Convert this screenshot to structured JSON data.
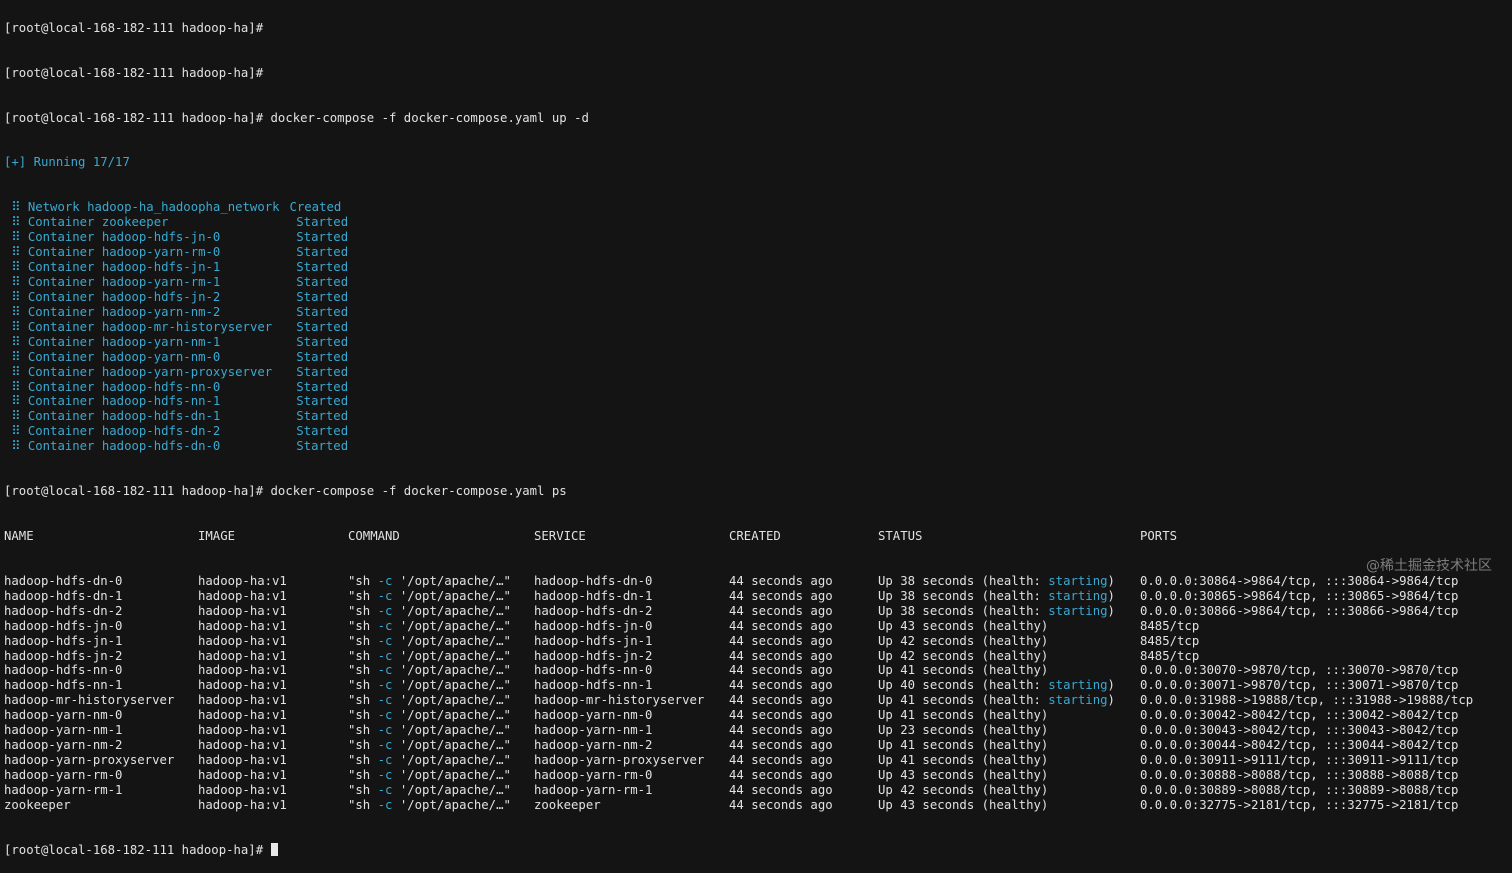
{
  "prompt": "[root@local-168-182-111 hadoop-ha]#",
  "up_command": "docker-compose -f docker-compose.yaml up -d",
  "ps_command": "docker-compose -f docker-compose.yaml ps",
  "running_status": "[+] Running 17/17",
  "compose_events": [
    {
      "kind": "Network",
      "name": "hadoop-ha_hadoopha_network",
      "state": "Created"
    },
    {
      "kind": "Container",
      "name": "zookeeper",
      "state": "Started"
    },
    {
      "kind": "Container",
      "name": "hadoop-hdfs-jn-0",
      "state": "Started"
    },
    {
      "kind": "Container",
      "name": "hadoop-yarn-rm-0",
      "state": "Started"
    },
    {
      "kind": "Container",
      "name": "hadoop-hdfs-jn-1",
      "state": "Started"
    },
    {
      "kind": "Container",
      "name": "hadoop-yarn-rm-1",
      "state": "Started"
    },
    {
      "kind": "Container",
      "name": "hadoop-hdfs-jn-2",
      "state": "Started"
    },
    {
      "kind": "Container",
      "name": "hadoop-yarn-nm-2",
      "state": "Started"
    },
    {
      "kind": "Container",
      "name": "hadoop-mr-historyserver",
      "state": "Started"
    },
    {
      "kind": "Container",
      "name": "hadoop-yarn-nm-1",
      "state": "Started"
    },
    {
      "kind": "Container",
      "name": "hadoop-yarn-nm-0",
      "state": "Started"
    },
    {
      "kind": "Container",
      "name": "hadoop-yarn-proxyserver",
      "state": "Started"
    },
    {
      "kind": "Container",
      "name": "hadoop-hdfs-nn-0",
      "state": "Started"
    },
    {
      "kind": "Container",
      "name": "hadoop-hdfs-nn-1",
      "state": "Started"
    },
    {
      "kind": "Container",
      "name": "hadoop-hdfs-dn-1",
      "state": "Started"
    },
    {
      "kind": "Container",
      "name": "hadoop-hdfs-dn-2",
      "state": "Started"
    },
    {
      "kind": "Container",
      "name": "hadoop-hdfs-dn-0",
      "state": "Started"
    }
  ],
  "ps_headers": {
    "name": "NAME",
    "image": "IMAGE",
    "command": "COMMAND",
    "service": "SERVICE",
    "created": "CREATED",
    "status": "STATUS",
    "ports": "PORTS"
  },
  "ps_rows": [
    {
      "name": "hadoop-hdfs-dn-0",
      "image": "hadoop-ha:v1",
      "cmd_pre": "\"sh ",
      "cmd_flag": "-c",
      "cmd_post": " '/opt/apache/…\"",
      "service": "hadoop-hdfs-dn-0",
      "created": "44 seconds ago",
      "status_pre": "Up 38 seconds (health: ",
      "status_hl": "starting",
      "status_post": ")",
      "ports": "0.0.0.0:30864->9864/tcp, :::30864->9864/tcp"
    },
    {
      "name": "hadoop-hdfs-dn-1",
      "image": "hadoop-ha:v1",
      "cmd_pre": "\"sh ",
      "cmd_flag": "-c",
      "cmd_post": " '/opt/apache/…\"",
      "service": "hadoop-hdfs-dn-1",
      "created": "44 seconds ago",
      "status_pre": "Up 38 seconds (health: ",
      "status_hl": "starting",
      "status_post": ")",
      "ports": "0.0.0.0:30865->9864/tcp, :::30865->9864/tcp"
    },
    {
      "name": "hadoop-hdfs-dn-2",
      "image": "hadoop-ha:v1",
      "cmd_pre": "\"sh ",
      "cmd_flag": "-c",
      "cmd_post": " '/opt/apache/…\"",
      "service": "hadoop-hdfs-dn-2",
      "created": "44 seconds ago",
      "status_pre": "Up 38 seconds (health: ",
      "status_hl": "starting",
      "status_post": ")",
      "ports": "0.0.0.0:30866->9864/tcp, :::30866->9864/tcp"
    },
    {
      "name": "hadoop-hdfs-jn-0",
      "image": "hadoop-ha:v1",
      "cmd_pre": "\"sh ",
      "cmd_flag": "-c",
      "cmd_post": " '/opt/apache/…\"",
      "service": "hadoop-hdfs-jn-0",
      "created": "44 seconds ago",
      "status_pre": "Up 43 seconds (healthy)",
      "status_hl": "",
      "status_post": "",
      "ports": "8485/tcp"
    },
    {
      "name": "hadoop-hdfs-jn-1",
      "image": "hadoop-ha:v1",
      "cmd_pre": "\"sh ",
      "cmd_flag": "-c",
      "cmd_post": " '/opt/apache/…\"",
      "service": "hadoop-hdfs-jn-1",
      "created": "44 seconds ago",
      "status_pre": "Up 42 seconds (healthy)",
      "status_hl": "",
      "status_post": "",
      "ports": "8485/tcp"
    },
    {
      "name": "hadoop-hdfs-jn-2",
      "image": "hadoop-ha:v1",
      "cmd_pre": "\"sh ",
      "cmd_flag": "-c",
      "cmd_post": " '/opt/apache/…\"",
      "service": "hadoop-hdfs-jn-2",
      "created": "44 seconds ago",
      "status_pre": "Up 42 seconds (healthy)",
      "status_hl": "",
      "status_post": "",
      "ports": "8485/tcp"
    },
    {
      "name": "hadoop-hdfs-nn-0",
      "image": "hadoop-ha:v1",
      "cmd_pre": "\"sh ",
      "cmd_flag": "-c",
      "cmd_post": " '/opt/apache/…\"",
      "service": "hadoop-hdfs-nn-0",
      "created": "44 seconds ago",
      "status_pre": "Up 41 seconds (healthy)",
      "status_hl": "",
      "status_post": "",
      "ports": "0.0.0.0:30070->9870/tcp, :::30070->9870/tcp"
    },
    {
      "name": "hadoop-hdfs-nn-1",
      "image": "hadoop-ha:v1",
      "cmd_pre": "\"sh ",
      "cmd_flag": "-c",
      "cmd_post": " '/opt/apache/…\"",
      "service": "hadoop-hdfs-nn-1",
      "created": "44 seconds ago",
      "status_pre": "Up 40 seconds (health: ",
      "status_hl": "starting",
      "status_post": ")",
      "ports": "0.0.0.0:30071->9870/tcp, :::30071->9870/tcp"
    },
    {
      "name": "hadoop-mr-historyserver",
      "image": "hadoop-ha:v1",
      "cmd_pre": "\"sh ",
      "cmd_flag": "-c",
      "cmd_post": " '/opt/apache/…\"",
      "service": "hadoop-mr-historyserver",
      "created": "44 seconds ago",
      "status_pre": "Up 41 seconds (health: ",
      "status_hl": "starting",
      "status_post": ")",
      "ports": "0.0.0.0:31988->19888/tcp, :::31988->19888/tcp"
    },
    {
      "name": "hadoop-yarn-nm-0",
      "image": "hadoop-ha:v1",
      "cmd_pre": "\"sh ",
      "cmd_flag": "-c",
      "cmd_post": " '/opt/apache/…\"",
      "service": "hadoop-yarn-nm-0",
      "created": "44 seconds ago",
      "status_pre": "Up 41 seconds (healthy)",
      "status_hl": "",
      "status_post": "",
      "ports": "0.0.0.0:30042->8042/tcp, :::30042->8042/tcp"
    },
    {
      "name": "hadoop-yarn-nm-1",
      "image": "hadoop-ha:v1",
      "cmd_pre": "\"sh ",
      "cmd_flag": "-c",
      "cmd_post": " '/opt/apache/…\"",
      "service": "hadoop-yarn-nm-1",
      "created": "44 seconds ago",
      "status_pre": "Up 23 seconds (healthy)",
      "status_hl": "",
      "status_post": "",
      "ports": "0.0.0.0:30043->8042/tcp, :::30043->8042/tcp"
    },
    {
      "name": "hadoop-yarn-nm-2",
      "image": "hadoop-ha:v1",
      "cmd_pre": "\"sh ",
      "cmd_flag": "-c",
      "cmd_post": " '/opt/apache/…\"",
      "service": "hadoop-yarn-nm-2",
      "created": "44 seconds ago",
      "status_pre": "Up 41 seconds (healthy)",
      "status_hl": "",
      "status_post": "",
      "ports": "0.0.0.0:30044->8042/tcp, :::30044->8042/tcp"
    },
    {
      "name": "hadoop-yarn-proxyserver",
      "image": "hadoop-ha:v1",
      "cmd_pre": "\"sh ",
      "cmd_flag": "-c",
      "cmd_post": " '/opt/apache/…\"",
      "service": "hadoop-yarn-proxyserver",
      "created": "44 seconds ago",
      "status_pre": "Up 41 seconds (healthy)",
      "status_hl": "",
      "status_post": "",
      "ports": "0.0.0.0:30911->9111/tcp, :::30911->9111/tcp"
    },
    {
      "name": "hadoop-yarn-rm-0",
      "image": "hadoop-ha:v1",
      "cmd_pre": "\"sh ",
      "cmd_flag": "-c",
      "cmd_post": " '/opt/apache/…\"",
      "service": "hadoop-yarn-rm-0",
      "created": "44 seconds ago",
      "status_pre": "Up 43 seconds (healthy)",
      "status_hl": "",
      "status_post": "",
      "ports": "0.0.0.0:30888->8088/tcp, :::30888->8088/tcp"
    },
    {
      "name": "hadoop-yarn-rm-1",
      "image": "hadoop-ha:v1",
      "cmd_pre": "\"sh ",
      "cmd_flag": "-c",
      "cmd_post": " '/opt/apache/…\"",
      "service": "hadoop-yarn-rm-1",
      "created": "44 seconds ago",
      "status_pre": "Up 42 seconds (healthy)",
      "status_hl": "",
      "status_post": "",
      "ports": "0.0.0.0:30889->8088/tcp, :::30889->8088/tcp"
    },
    {
      "name": "zookeeper",
      "image": "hadoop-ha:v1",
      "cmd_pre": "\"sh ",
      "cmd_flag": "-c",
      "cmd_post": " '/opt/apache/…\"",
      "service": "zookeeper",
      "created": "44 seconds ago",
      "status_pre": "Up 43 seconds (healthy)",
      "status_hl": "",
      "status_post": "",
      "ports": "0.0.0.0:32775->2181/tcp, :::32775->2181/tcp"
    }
  ],
  "watermark": "@稀土掘金技术社区",
  "colors": {
    "background": "#141414",
    "text": "#e2e2e2",
    "accent_blue": "#3aa8d0"
  }
}
